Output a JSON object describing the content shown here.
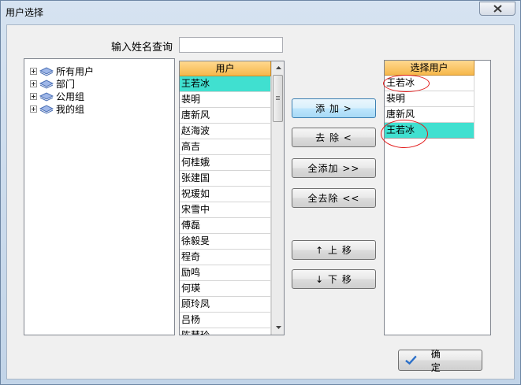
{
  "window": {
    "title": "用户选择"
  },
  "search": {
    "label": "输入姓名查询",
    "value": "",
    "placeholder": ""
  },
  "tree": {
    "items": [
      "所有用户",
      "部门",
      "公用组",
      "我的组"
    ]
  },
  "user_grid": {
    "header": "用户",
    "rows": [
      "王若冰",
      "裴明",
      "唐新风",
      "赵海波",
      "高吉",
      "何桂娥",
      "张建国",
      "祝瑗如",
      "宋雪中",
      "傅磊",
      "徐毅旻",
      "程奇",
      "励鸣",
      "何瑛",
      "顾玲凤",
      "吕杨",
      "陈慧玲"
    ],
    "selected_index": 0
  },
  "buttons": {
    "add": "添 加 >",
    "remove": "去 除 <",
    "add_all": "全添加 >>",
    "remove_all": "全去除 <<",
    "move_up": "↑   上   移",
    "move_down": "↓   下   移",
    "ok": "确 定"
  },
  "selected_grid": {
    "header": "选择用户",
    "rows": [
      "王若冰",
      "裴明",
      "唐新风",
      "王若冰"
    ],
    "selected_index": 3
  },
  "colors": {
    "selection": "#40e0d0",
    "header": "#f6b84a",
    "annotation": "#e21b1b"
  }
}
